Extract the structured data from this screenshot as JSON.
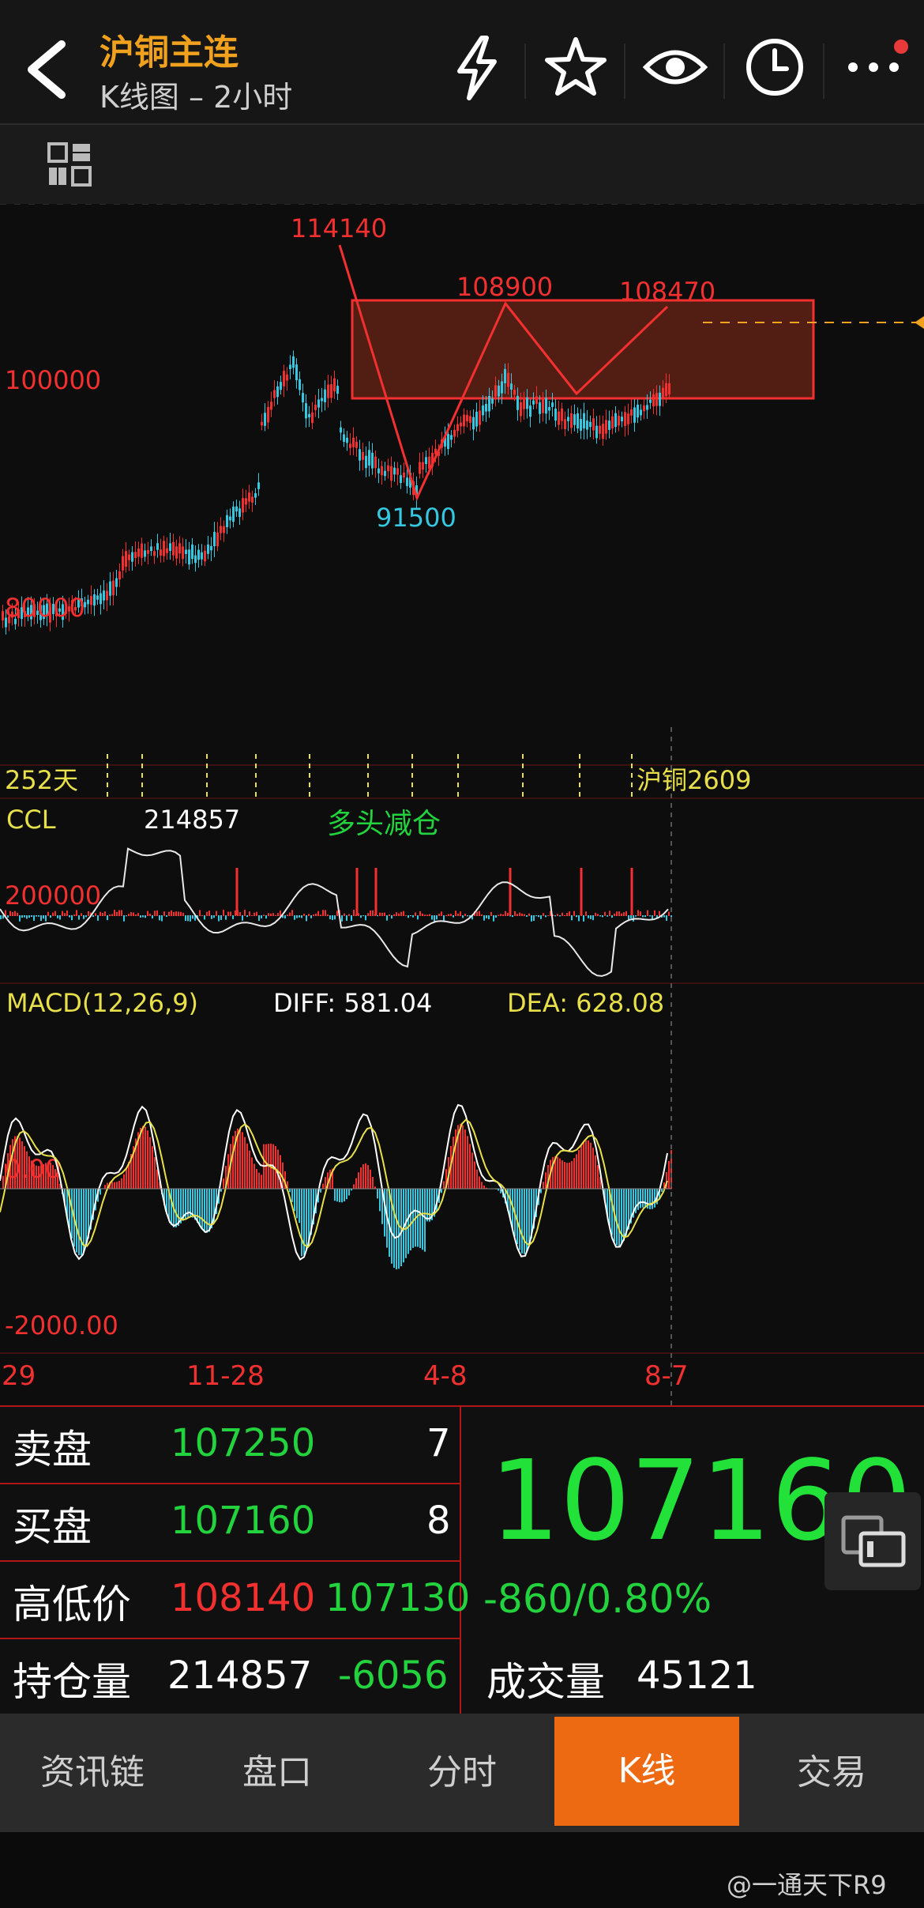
{
  "header": {
    "title": "沪铜主连",
    "subtitle": "K线图 – 2小时",
    "icons": [
      "back-icon",
      "flash-icon",
      "star-icon",
      "eye-icon",
      "clock-icon",
      "more-icon"
    ]
  },
  "chart": {
    "annotations": {
      "high": "114140",
      "low": "91500",
      "peak2": "108900",
      "peak3": "108470",
      "price_100k": "100000",
      "price_80k": "80000"
    },
    "timeline": {
      "left_label": "252天",
      "right_label": "沪铜2609"
    },
    "ccl": {
      "label": "CCL",
      "value": "214857",
      "status": "多头减仓",
      "level": "200000"
    },
    "macd": {
      "label": "MACD(12,26,9)",
      "diff": "DIFF: 581.04",
      "dea": "DEA: 628.08",
      "zero": "0.00",
      "low": "-2000.00"
    },
    "dates": [
      "29",
      "11-28",
      "4-8",
      "8-7"
    ],
    "colors": {
      "up": "#f23030",
      "down": "#35c8e0",
      "accent": "#f0a11d",
      "yellow": "#e8e04a",
      "green": "#22d33e"
    }
  },
  "quote": {
    "sell_label": "卖盘",
    "sell_price": "107250",
    "sell_qty": "7",
    "buy_label": "买盘",
    "buy_price": "107160",
    "buy_qty": "8",
    "hl_label": "高低价",
    "high": "108140",
    "low": "107130",
    "oi_label": "持仓量",
    "oi": "214857",
    "oi_change": "-6056",
    "last_price": "107160",
    "change": "-860/0.80%",
    "volume_label": "成交量",
    "volume": "45121"
  },
  "tabs": [
    "资讯链",
    "盘口",
    "分时",
    "K线",
    "交易"
  ],
  "active_tab": "K线",
  "watermark": "@一通天下R9"
}
